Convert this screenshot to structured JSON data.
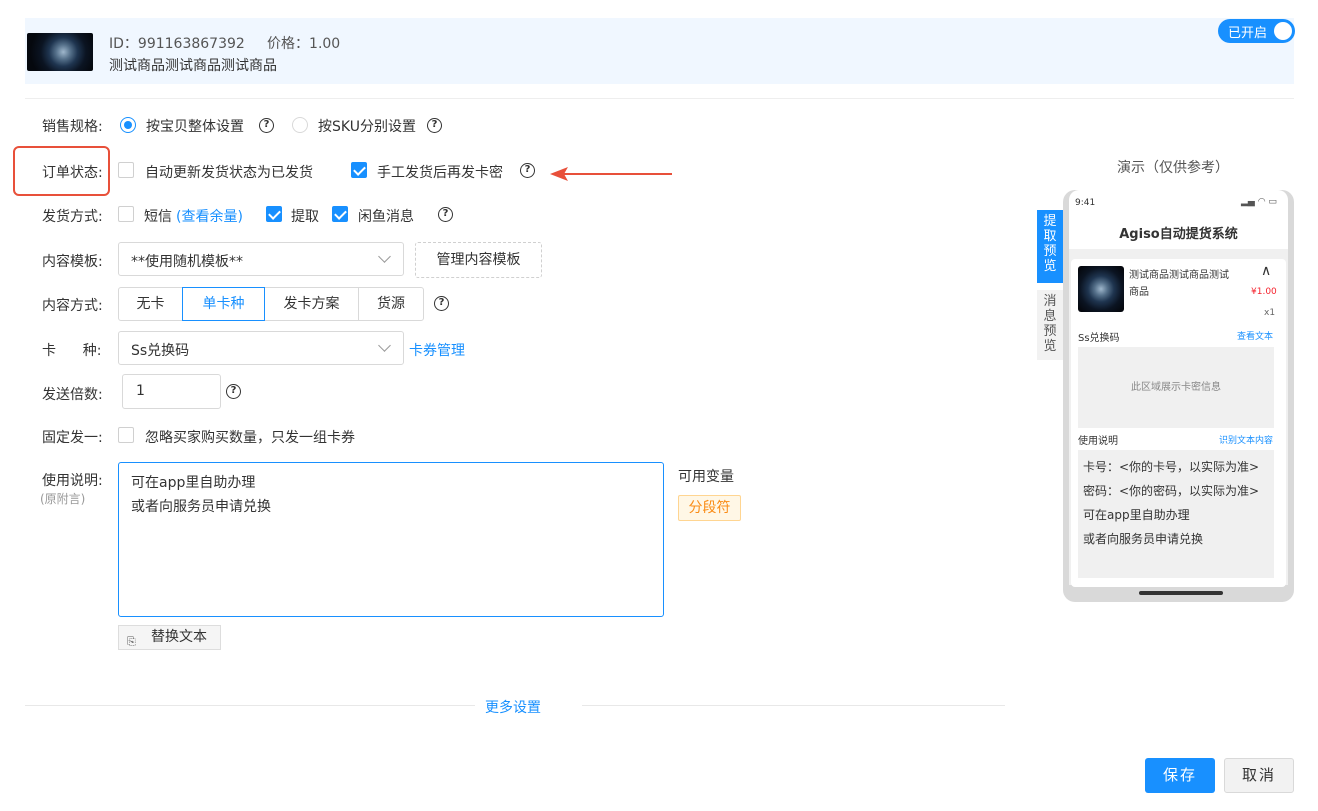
{
  "product": {
    "id_line": "ID：991163867392     价格：1.00",
    "name": "测试商品测试商品测试商品",
    "toggle_label": "已开启"
  },
  "form": {
    "sales_spec": {
      "label": "销售规格:",
      "option_whole": "按宝贝整体设置",
      "option_sku": "按SKU分别设置",
      "selected": "按宝贝整体设置"
    },
    "order_status": {
      "label": "订单状态:",
      "auto_update": "自动更新发货状态为已发货",
      "auto_update_checked": false,
      "manual_resend": "手工发货后再发卡密",
      "manual_resend_checked": true
    },
    "ship_method": {
      "label": "发货方式:",
      "sms": "短信",
      "sms_checked": false,
      "balance_link": "(查看余量)",
      "pickup": "提取",
      "pickup_checked": true,
      "xianyu": "闲鱼消息",
      "xianyu_checked": true
    },
    "content_template": {
      "label": "内容模板:",
      "value": "**使用随机模板**",
      "manage_button": "管理内容模板"
    },
    "content_mode": {
      "label": "内容方式:",
      "options": [
        "无卡",
        "单卡种",
        "发卡方案",
        "货源"
      ],
      "selected": "单卡种"
    },
    "card_type": {
      "label": "卡      种:",
      "value": "Ss兑换码",
      "manage_link": "卡券管理"
    },
    "send_multiple": {
      "label": "发送倍数:",
      "value": "1"
    },
    "fixed_one": {
      "label": "固定发一:",
      "text": "忽略买家购买数量，只发一组卡券",
      "checked": false
    },
    "instructions": {
      "label": "使用说明:",
      "sublabel": "(原附言)",
      "value": "可在app里自助办理\n或者向服务员申请兑换",
      "variables_label": "可用变量",
      "separator_tag": "分段符",
      "replace_button": "替换文本"
    },
    "more_settings": "更多设置",
    "save": "保存",
    "cancel": "取消"
  },
  "preview": {
    "title": "演示（仅供参考）",
    "tabs": [
      "提取预览",
      "消息预览"
    ],
    "active_tab": "提取预览",
    "phone": {
      "time": "9:41",
      "app_title": "Agiso自动提货系统",
      "product_name": "测试商品测试商品测试商品",
      "price": "¥1.00",
      "qty": "x1",
      "card_label": "Ss兑换码",
      "view_text_link": "查看文本",
      "card_placeholder": "此区域展示卡密信息",
      "usage_label": "使用说明",
      "recognize_link": "识别文本内容",
      "usage_lines": [
        "卡号：<你的卡号，以实际为准>密码：<你的密码，以实际为准>",
        "可在app里自助办理",
        "或者向服务员申请兑换"
      ]
    }
  },
  "colors": {
    "primary": "#1890ff",
    "annotation_red": "#e8503a",
    "price_red": "#f5222d",
    "tag_orange": "#fa8c16"
  }
}
